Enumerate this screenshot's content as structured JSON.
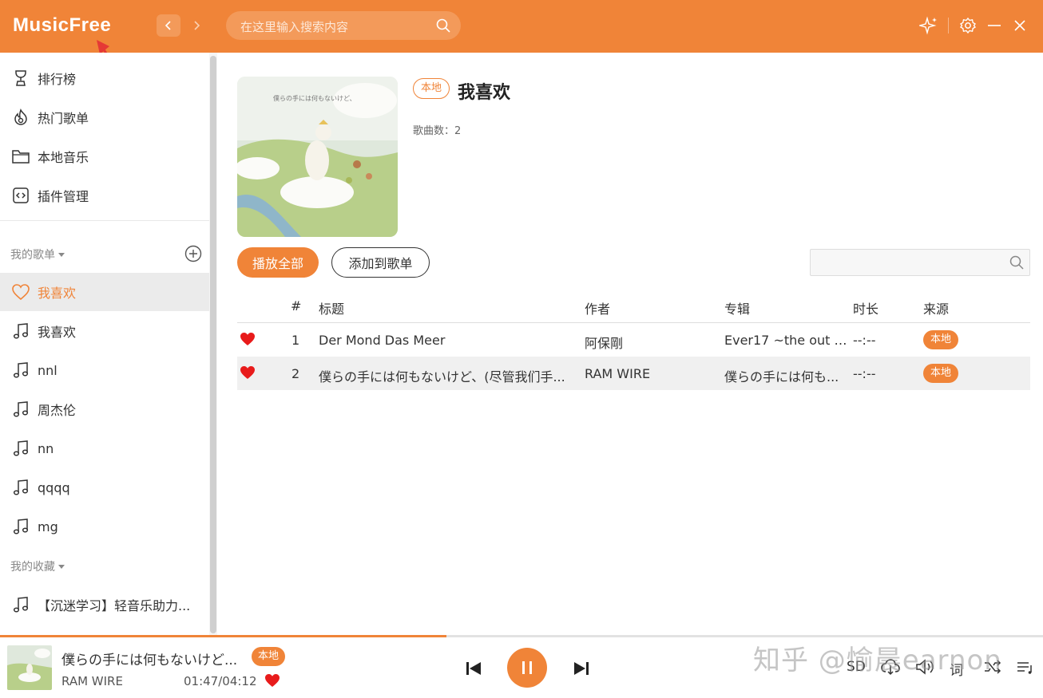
{
  "app": {
    "title": "MusicFree"
  },
  "header": {
    "search_placeholder": "在这里输入搜索内容"
  },
  "sidebar": {
    "menu": [
      {
        "label": "排行榜",
        "icon": "trophy-icon"
      },
      {
        "label": "热门歌单",
        "icon": "flame-icon"
      },
      {
        "label": "本地音乐",
        "icon": "folder-icon"
      },
      {
        "label": "插件管理",
        "icon": "plugin-icon"
      }
    ],
    "my_playlists_label": "我的歌单",
    "playlists": [
      {
        "label": "我喜欢",
        "icon": "heart-icon",
        "active": true
      },
      {
        "label": "我喜欢",
        "icon": "music-note-icon"
      },
      {
        "label": "nnl",
        "icon": "music-note-icon"
      },
      {
        "label": "周杰伦",
        "icon": "music-note-icon"
      },
      {
        "label": "nn",
        "icon": "music-note-icon"
      },
      {
        "label": "qqqq",
        "icon": "music-note-icon"
      },
      {
        "label": "mg",
        "icon": "music-note-icon"
      }
    ],
    "my_favorites_label": "我的收藏",
    "favorites": [
      {
        "label": "【沉迷学习】轻音乐助力...",
        "icon": "music-note-icon"
      }
    ]
  },
  "playlist": {
    "tag": "本地",
    "title": "我喜欢",
    "song_count_label": "歌曲数：2",
    "play_all_label": "播放全部",
    "add_to_playlist_label": "添加到歌单",
    "columns": {
      "index": "#",
      "title": "标题",
      "artist": "作者",
      "album": "专辑",
      "duration": "时长",
      "source": "来源"
    },
    "songs": [
      {
        "index": "1",
        "title": "Der Mond Das Meer",
        "artist": "阿保剛",
        "album": "Ever17 ~the out o...",
        "duration": "--:--",
        "source": "本地"
      },
      {
        "index": "2",
        "title": "僕らの手には何もないけど、(尽管我们手...",
        "artist": "RAM WIRE",
        "album": "僕らの手には何も...",
        "duration": "--:--",
        "source": "本地"
      }
    ]
  },
  "player": {
    "title": "僕らの手には何もないけど...",
    "badge": "本地",
    "artist": "RAM WIRE",
    "time": "01:47/04:12",
    "progress": 0.428,
    "quality": "SD",
    "lyrics": "词"
  },
  "watermark": "知乎 @愉晨earnon",
  "colors": {
    "accent": "#f08438",
    "heart": "#e81b1b"
  }
}
